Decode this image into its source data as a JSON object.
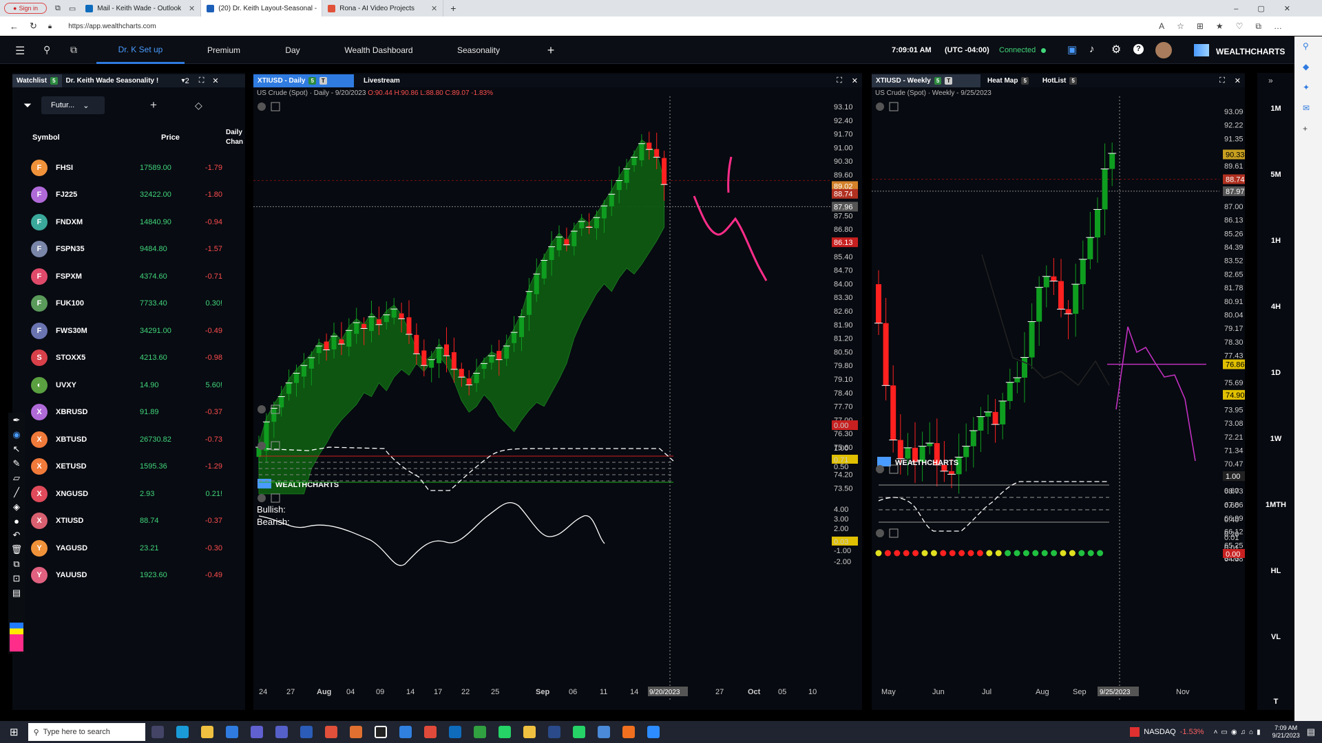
{
  "browser": {
    "signin": "Sign in",
    "tabs": [
      {
        "label": "Mail - Keith Wade - Outlook",
        "color": "#0f6cbd"
      },
      {
        "label": "(20) Dr. Keith Layout-Seasonal -",
        "color": "#1c5fb8"
      },
      {
        "label": "Rona - AI Video Projects",
        "color": "#e0533a"
      }
    ],
    "url": "https://app.wealthcharts.com"
  },
  "nav": {
    "tabs": [
      "Dr. K Set up",
      "Premium",
      "Day",
      "Wealth Dashboard",
      "Seasonality"
    ],
    "add": "+",
    "time": "7:09:01 AM",
    "timezone": "(UTC -04:00)",
    "status": "Connected",
    "brand": "WEALTHCHARTS"
  },
  "watchlist": {
    "tab": "Watchlist",
    "tab_badge": "5",
    "title": "Dr. Keith Wade Seasonality !",
    "count": "2",
    "filter_label": "Futur...",
    "headers": {
      "symbol": "Symbol",
      "price": "Price",
      "change": "Daily Chan"
    },
    "rows": [
      {
        "letter": "F",
        "color": "#f0923a",
        "symbol": "FHSI",
        "price": "17589.00",
        "change": "-1.79",
        "neg": true
      },
      {
        "letter": "F",
        "color": "#b06ad8",
        "symbol": "FJ225",
        "price": "32422.00",
        "change": "-1.80",
        "neg": true
      },
      {
        "letter": "F",
        "color": "#3aa89b",
        "symbol": "FNDXM",
        "price": "14840.90",
        "change": "-0.94",
        "neg": true
      },
      {
        "letter": "F",
        "color": "#7a86a8",
        "symbol": "FSPN35",
        "price": "9484.80",
        "change": "-1.57",
        "neg": true
      },
      {
        "letter": "F",
        "color": "#e04a6a",
        "symbol": "FSPXM",
        "price": "4374.60",
        "change": "-0.71",
        "neg": true
      },
      {
        "letter": "F",
        "color": "#5a9a5a",
        "symbol": "FUK100",
        "price": "7733.40",
        "change": "0.30!",
        "neg": false
      },
      {
        "letter": "F",
        "color": "#6a74b0",
        "symbol": "FWS30M",
        "price": "34291.00",
        "change": "-0.49",
        "neg": true
      },
      {
        "letter": "S",
        "color": "#d8404a",
        "symbol": "STOXX5",
        "price": "4213.60",
        "change": "-0.98",
        "neg": true
      },
      {
        "letter": "",
        "color": "#5aa040",
        "symbol": "UVXY",
        "price": "14.90",
        "change": "5.60!",
        "neg": false
      },
      {
        "letter": "X",
        "color": "#b06ad8",
        "symbol": "XBRUSD",
        "price": "91.89",
        "change": "-0.37",
        "neg": true
      },
      {
        "letter": "X",
        "color": "#f07a3a",
        "symbol": "XBTUSD",
        "price": "26730.82",
        "change": "-0.73",
        "neg": true
      },
      {
        "letter": "X",
        "color": "#f07a3a",
        "symbol": "XETUSD",
        "price": "1595.36",
        "change": "-1.29",
        "neg": true
      },
      {
        "letter": "X",
        "color": "#e04a5a",
        "symbol": "XNGUSD",
        "price": "2.93",
        "change": "0.21!",
        "neg": false
      },
      {
        "letter": "X",
        "color": "#d86070",
        "symbol": "XTIUSD",
        "price": "88.74",
        "change": "-0.37",
        "neg": true
      },
      {
        "letter": "Y",
        "color": "#f0923a",
        "symbol": "YAGUSD",
        "price": "23.21",
        "change": "-0.30",
        "neg": true
      },
      {
        "letter": "Y",
        "color": "#e06080",
        "symbol": "YAUUSD",
        "price": "1923.60",
        "change": "-0.49",
        "neg": true
      }
    ]
  },
  "daily": {
    "tab": "XTIUSD - Daily",
    "tab_badge": "5",
    "tab_t": "T",
    "tab2": "Livestream",
    "info": "US Crude (Spot) · Daily - 9/20/2023",
    "ohlc": "O:90.44 H:90.86 L:88.80 C:89.07 -1.83%",
    "brand": "WEALTHCHARTS",
    "y_ticks": [
      "93.10",
      "92.40",
      "91.70",
      "91.00",
      "90.30",
      "89.60",
      "87.50",
      "86.80",
      "85.40",
      "84.70",
      "84.00",
      "83.30",
      "82.60",
      "81.90",
      "81.20",
      "80.50",
      "79.80",
      "79.10",
      "78.40",
      "77.70",
      "77.00",
      "76.30",
      "75.60",
      "74.90",
      "74.20",
      "73.50"
    ],
    "labels": {
      "last": "89.02",
      "last2": "88.74",
      "cross": "87.96",
      "red": "86.13",
      "osc1": "0.00",
      "osc2": "0.71",
      "osc3": "0.03"
    },
    "osc_ticks": {
      "a": "0.01",
      "b": [
        "1.00",
        "0.50"
      ],
      "c": [
        "4.00",
        "3.00",
        "2.00",
        "1.00",
        "-1.00",
        "-2.00"
      ]
    },
    "bull": "Bullish:",
    "bear": "Bearish:",
    "x_ticks": [
      "24",
      "27",
      "Aug",
      "04",
      "09",
      "14",
      "17",
      "22",
      "25",
      "Sep",
      "06",
      "11",
      "14",
      "9/20/2023",
      "27",
      "Oct",
      "05",
      "10"
    ]
  },
  "weekly": {
    "tab": "XTIUSD - Weekly",
    "tab_badge": "5",
    "tab_t": "T",
    "tab2": "Heat Map",
    "tab2_badge": "5",
    "tab3": "HotList",
    "tab3_badge": "5",
    "info": "US Crude (Spot) · Weekly - 9/25/2023",
    "brand": "WEALTHCHARTS",
    "y_ticks": [
      "93.09",
      "92.22",
      "91.35",
      "89.61",
      "87.00",
      "86.13",
      "85.26",
      "84.39",
      "83.52",
      "82.65",
      "81.78",
      "80.91",
      "80.04",
      "79.17",
      "78.30",
      "77.43",
      "75.69",
      "73.95",
      "73.08",
      "72.21",
      "71.34",
      "70.47",
      "69.60",
      "68.73",
      "67.86",
      "66.99",
      "66.12",
      "65.25",
      "64.38"
    ],
    "labels": {
      "a": "90.33",
      "b": "88.74",
      "c": "87.97",
      "d": "76.86",
      "e": "74.90",
      "osc1": "1.00",
      "osc2": "0.00"
    },
    "osc_ticks": [
      "0.80",
      "0.60",
      "0.40",
      "0.20"
    ],
    "osc_ticks2": [
      "0.01",
      "0.01",
      "0.00"
    ],
    "x_ticks": [
      "May",
      "Jun",
      "Jul",
      "Aug",
      "Sep",
      "9/25/2023",
      "Nov"
    ]
  },
  "timeframes": [
    "1M",
    "5M",
    "1H",
    "4H",
    "1D",
    "1W",
    "1MTH",
    "HL",
    "VL",
    "T"
  ],
  "taskbar": {
    "search": "Type here to search",
    "ticker": "NASDAQ",
    "ticker_change": "-1.53%",
    "time": "7:09 AM",
    "date": "9/21/2023"
  },
  "colors": {
    "up": "#0f9d20",
    "down": "#ff2020",
    "accent": "#2f7be0",
    "pink": "#ff2d8a",
    "purple": "#c030c0"
  }
}
